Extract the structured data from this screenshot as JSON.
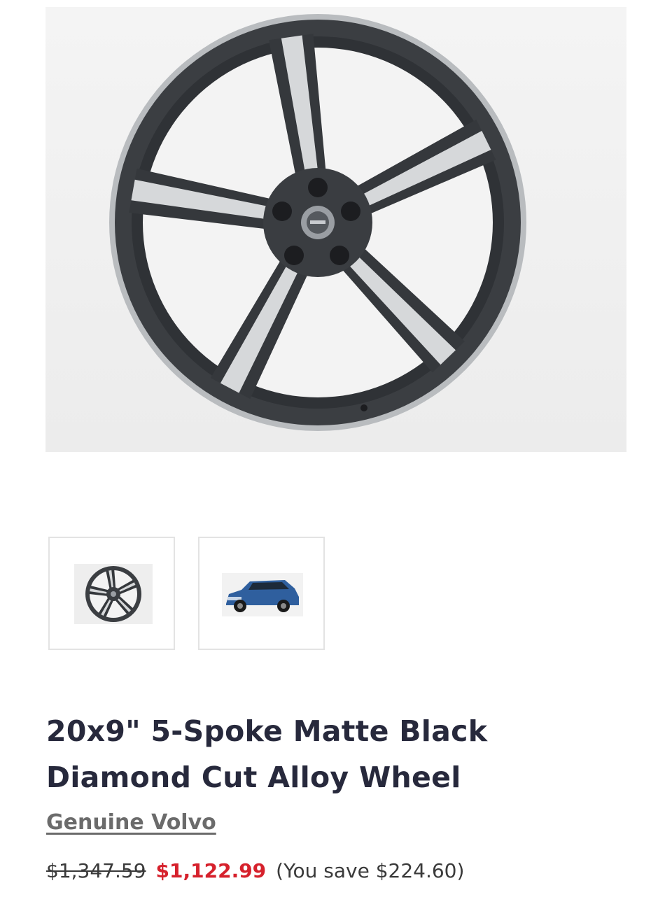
{
  "hero_image": {
    "icon": "wheel-product-image"
  },
  "thumbnails": [
    {
      "icon": "wheel-thumbnail"
    },
    {
      "icon": "car-thumbnail"
    }
  ],
  "product": {
    "title": "20x9\" 5-Spoke Matte Black Diamond Cut Alloy Wheel",
    "brand": "Genuine Volvo",
    "price_original": "$1,347.59",
    "price_sale": "$1,122.99",
    "savings": "(You save $224.60)"
  },
  "colors": {
    "sale_price": "#d6212c",
    "title": "#27293c",
    "brand_link": "#6b6b6b"
  }
}
